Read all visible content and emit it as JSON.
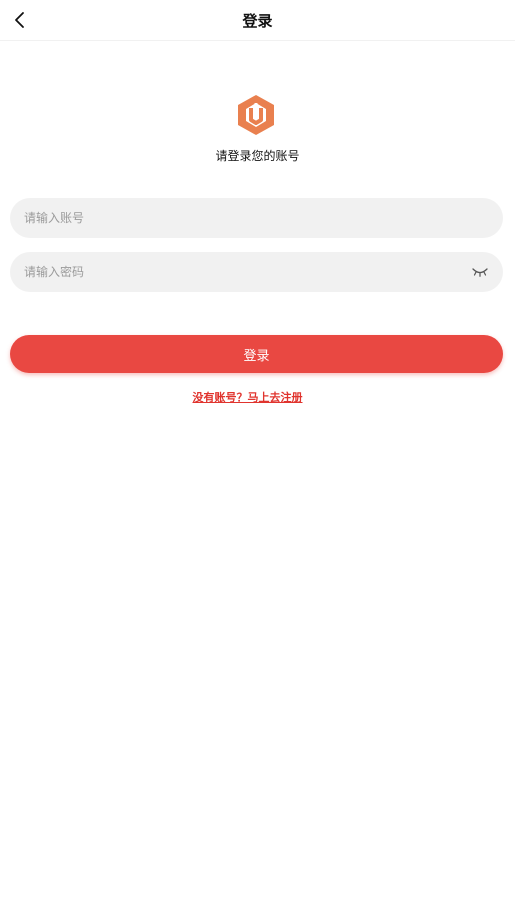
{
  "header": {
    "title": "登录"
  },
  "login": {
    "subtitle": "请登录您的账号",
    "account_placeholder": "请输入账号",
    "password_placeholder": "请输入密码",
    "submit_label": "登录",
    "register_link": "没有账号？马上去注册"
  },
  "icons": {
    "back": "chevron-left-icon",
    "logo": "hexagon-logo-icon",
    "password_toggle": "eye-closed-icon"
  },
  "colors": {
    "accent": "#e94842",
    "link": "#e0342e",
    "logo": "#e9804f",
    "input_bg": "#f1f1f1"
  }
}
